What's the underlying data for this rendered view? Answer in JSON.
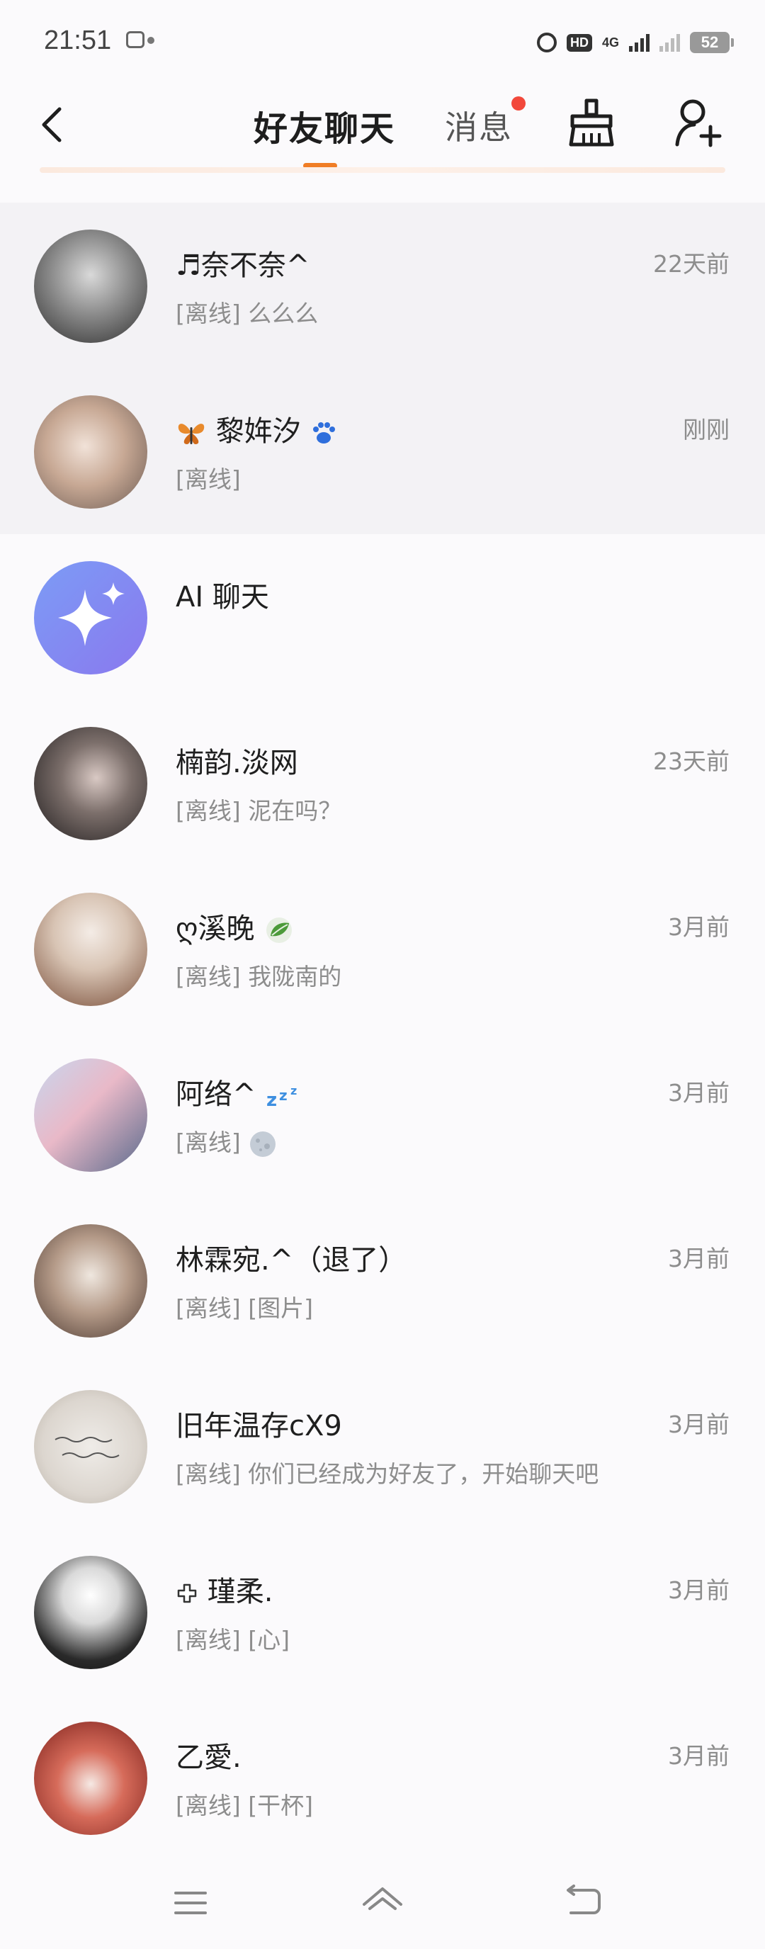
{
  "status_bar": {
    "time": "21:51",
    "network": "4G",
    "battery": "52"
  },
  "header": {
    "tab_friends": "好友聊天",
    "tab_messages": "消息",
    "accent_color": "#f07d25",
    "badge_color": "#f2483b"
  },
  "chats": [
    {
      "name": "♬奈不奈^",
      "msg": "[离线] 么么么",
      "time": "22天前",
      "pinned": true
    },
    {
      "name": "黎姩汐",
      "msg": "[离线]",
      "time": "刚刚",
      "pinned": true
    },
    {
      "name": "AI 聊天",
      "msg": "",
      "time": ""
    },
    {
      "name": "楠韵.淡网",
      "msg": "[离线] 泥在吗？",
      "time": "23天前"
    },
    {
      "name": "ღ溪晚",
      "msg": "[离线] 我陇南的",
      "time": "3月前"
    },
    {
      "name": "阿络^",
      "msg": "[离线]",
      "time": "3月前"
    },
    {
      "name": "林霖宛.^（退了）",
      "msg": "[离线] [图片]",
      "time": "3月前"
    },
    {
      "name": "旧年温存cX9",
      "msg": "[离线] 你们已经成为好友了，开始聊天吧",
      "time": "3月前"
    },
    {
      "name": "瑾柔.",
      "msg": "[离线] [心]",
      "time": "3月前"
    },
    {
      "name": "乙愛.",
      "msg": "[离线] [干杯]",
      "time": "3月前"
    }
  ]
}
